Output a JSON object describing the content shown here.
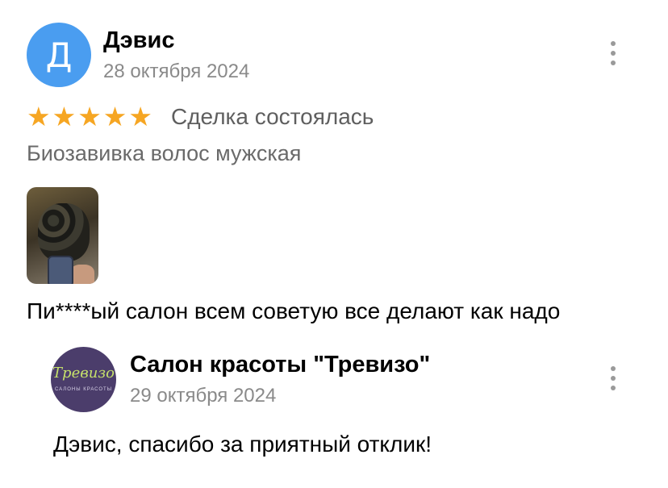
{
  "review": {
    "avatar_letter": "Д",
    "author": "Дэвис",
    "date": "28 октября 2024",
    "rating": 5,
    "deal_status": "Сделка состоялась",
    "service": "Биозавивка волос мужская",
    "text": "Пи****ый салон всем советую все делают как надо"
  },
  "response": {
    "logo_text": "Тревизо",
    "logo_subtext": "САЛОНЫ КРАСОТЫ",
    "author": "Салон красоты \"Тревизо\"",
    "date": "29 октября 2024",
    "text": "Дэвис, спасибо за приятный отклик!"
  },
  "colors": {
    "avatar": "#4a9df0",
    "star": "#f6a623",
    "logo_bg": "#4b3d6b",
    "logo_text": "#c5e06b"
  }
}
